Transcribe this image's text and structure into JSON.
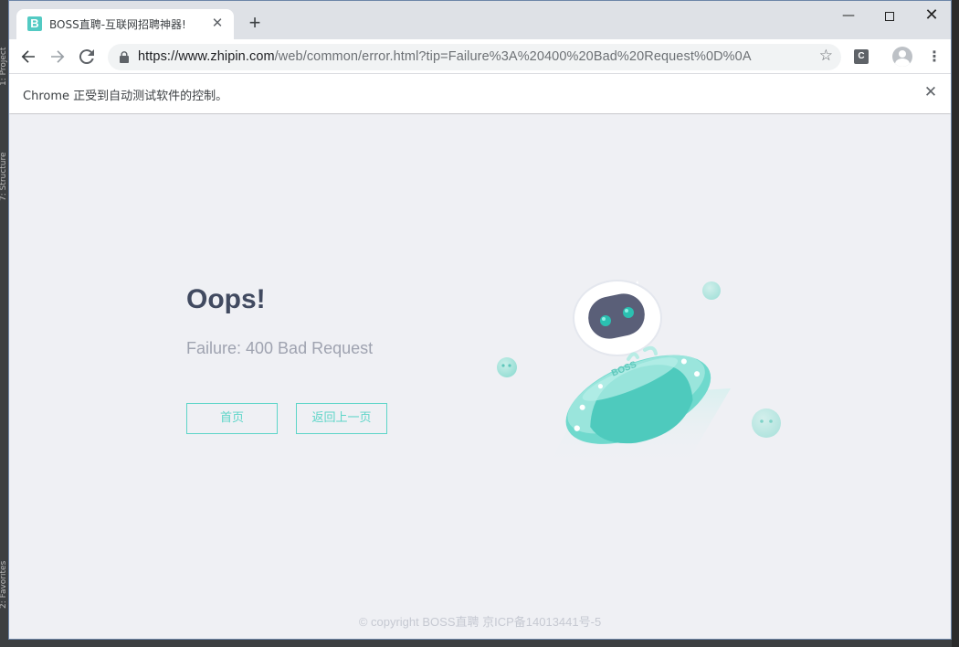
{
  "ide": {
    "left_label_top": "1: Project",
    "left_label_mid": "7: Structure",
    "left_label_bottom": "2: Favorites"
  },
  "browser": {
    "tab": {
      "favicon_letter": "B",
      "title": "BOSS直聘-互联网招聘神器!"
    },
    "address": {
      "host": "https://www.zhipin.com",
      "path": "/web/common/error.html?tip=Failure%3A%20400%20Bad%20Request%0D%0A"
    },
    "extension_letter": "C",
    "infobar_text": "Chrome 正受到自动测试软件的控制。"
  },
  "page": {
    "heading": "Oops!",
    "message": "Failure: 400 Bad Request",
    "home_button": "首页",
    "back_button": "返回上一页",
    "illustration_label": "BOSS",
    "footer": "© copyright BOSS直聘 京ICP备14013441号-5"
  },
  "colors": {
    "accent": "#5dd5c8",
    "heading": "#414a60",
    "message": "#9fa3b0",
    "page_bg": "#eff0f4"
  }
}
